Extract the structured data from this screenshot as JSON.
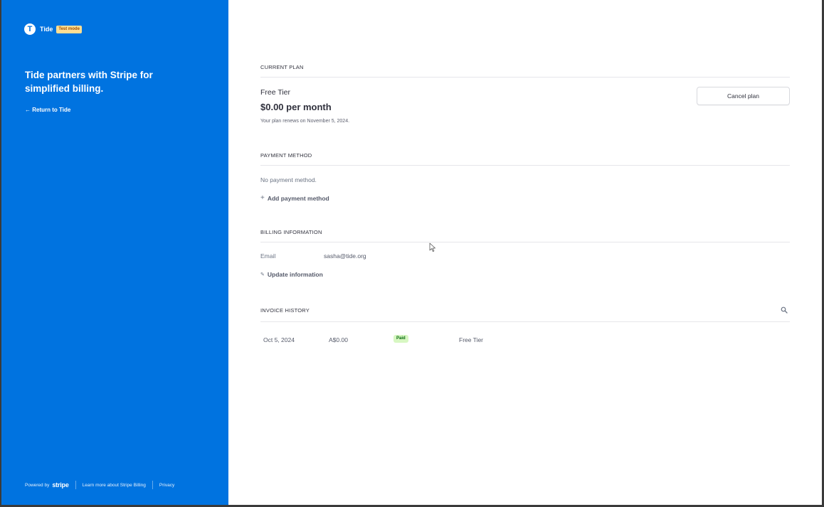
{
  "brand": {
    "name": "Tide",
    "logo_letter": "T",
    "badge": "Test mode",
    "color": "#0073e0"
  },
  "sidebar": {
    "tagline": "Tide partners with Stripe for simplified billing.",
    "return_link": "← Return to Tide",
    "footer": {
      "powered_by": "Powered by",
      "stripe": "stripe",
      "learn_more": "Learn more about Stripe Billing",
      "privacy": "Privacy"
    }
  },
  "current_plan": {
    "section_title": "CURRENT PLAN",
    "name": "Free Tier",
    "price": "$0.00 per month",
    "renewal": "Your plan renews on November 5, 2024.",
    "cancel_label": "Cancel plan"
  },
  "payment_method": {
    "section_title": "PAYMENT METHOD",
    "empty_text": "No payment method.",
    "add_label": "Add payment method"
  },
  "billing_info": {
    "section_title": "BILLING INFORMATION",
    "email_label": "Email",
    "email_value": "sasha@tide.org",
    "update_label": "Update information"
  },
  "invoice_history": {
    "section_title": "INVOICE HISTORY",
    "rows": [
      {
        "date": "Oct 5, 2024",
        "amount": "A$0.00",
        "status": "Paid",
        "plan": "Free Tier"
      }
    ]
  }
}
